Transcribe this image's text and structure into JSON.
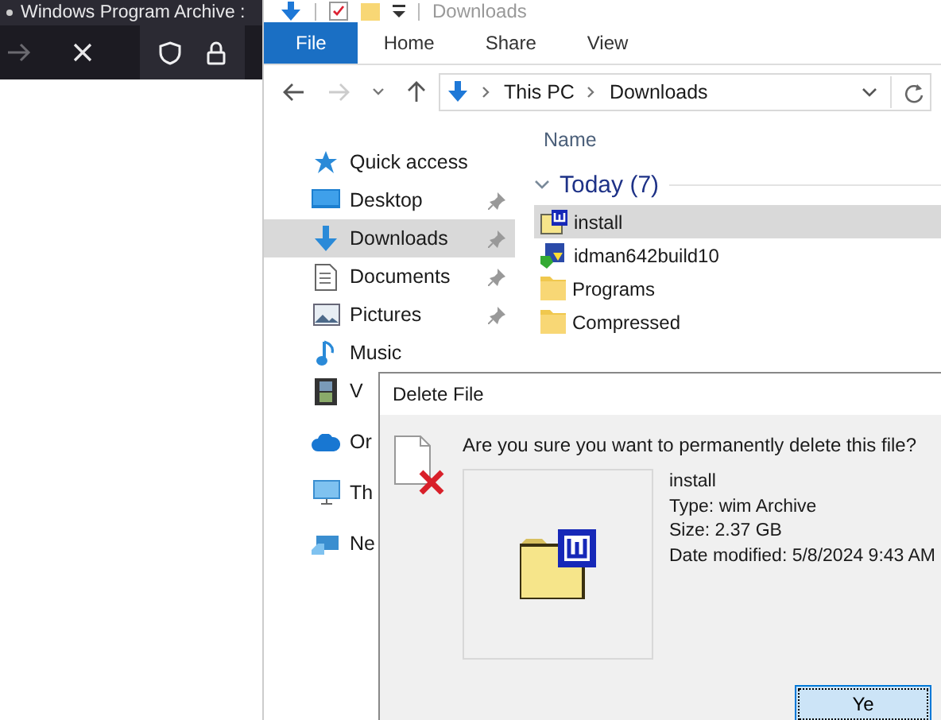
{
  "browser": {
    "tab_title": "Windows Program Archive :"
  },
  "explorer": {
    "title": "Downloads",
    "ribbon_tabs": [
      {
        "label": "File",
        "selected": true
      },
      {
        "label": "Home",
        "selected": false
      },
      {
        "label": "Share",
        "selected": false
      },
      {
        "label": "View",
        "selected": false
      }
    ],
    "address": {
      "path": [
        "This PC",
        "Downloads"
      ]
    },
    "column_header": "Name",
    "sidebar": [
      {
        "label": "Quick access",
        "kind": "star",
        "pinned": false,
        "selected": false
      },
      {
        "label": "Desktop",
        "kind": "desktop",
        "pinned": true,
        "selected": false
      },
      {
        "label": "Downloads",
        "kind": "download",
        "pinned": true,
        "selected": true
      },
      {
        "label": "Documents",
        "kind": "document",
        "pinned": true,
        "selected": false
      },
      {
        "label": "Pictures",
        "kind": "pictures",
        "pinned": true,
        "selected": false
      },
      {
        "label": "Music",
        "kind": "music",
        "pinned": false,
        "selected": false
      },
      {
        "label": "V",
        "kind": "video",
        "selected": false
      },
      {
        "label": "Or",
        "kind": "cloud",
        "selected": false
      },
      {
        "label": "Th",
        "kind": "pc",
        "selected": false
      },
      {
        "label": "Ne",
        "kind": "network",
        "selected": false
      }
    ],
    "group": {
      "label": "Today (7)",
      "expanded": true
    },
    "files": [
      {
        "name": "install",
        "kind": "wim",
        "selected": true
      },
      {
        "name": "idman642build10",
        "kind": "exe",
        "selected": false
      },
      {
        "name": "Programs",
        "kind": "folder",
        "selected": false
      },
      {
        "name": "Compressed",
        "kind": "folder",
        "selected": false
      }
    ]
  },
  "dialog": {
    "title": "Delete File",
    "message": "Are you sure you want to permanently delete this file?",
    "file": {
      "name": "install",
      "details": [
        "Type: wim Archive",
        "Size: 2.37 GB",
        "Date modified: 5/8/2024 9:43 AM"
      ]
    },
    "buttons": [
      {
        "label": "Ye",
        "focused": true
      }
    ]
  }
}
